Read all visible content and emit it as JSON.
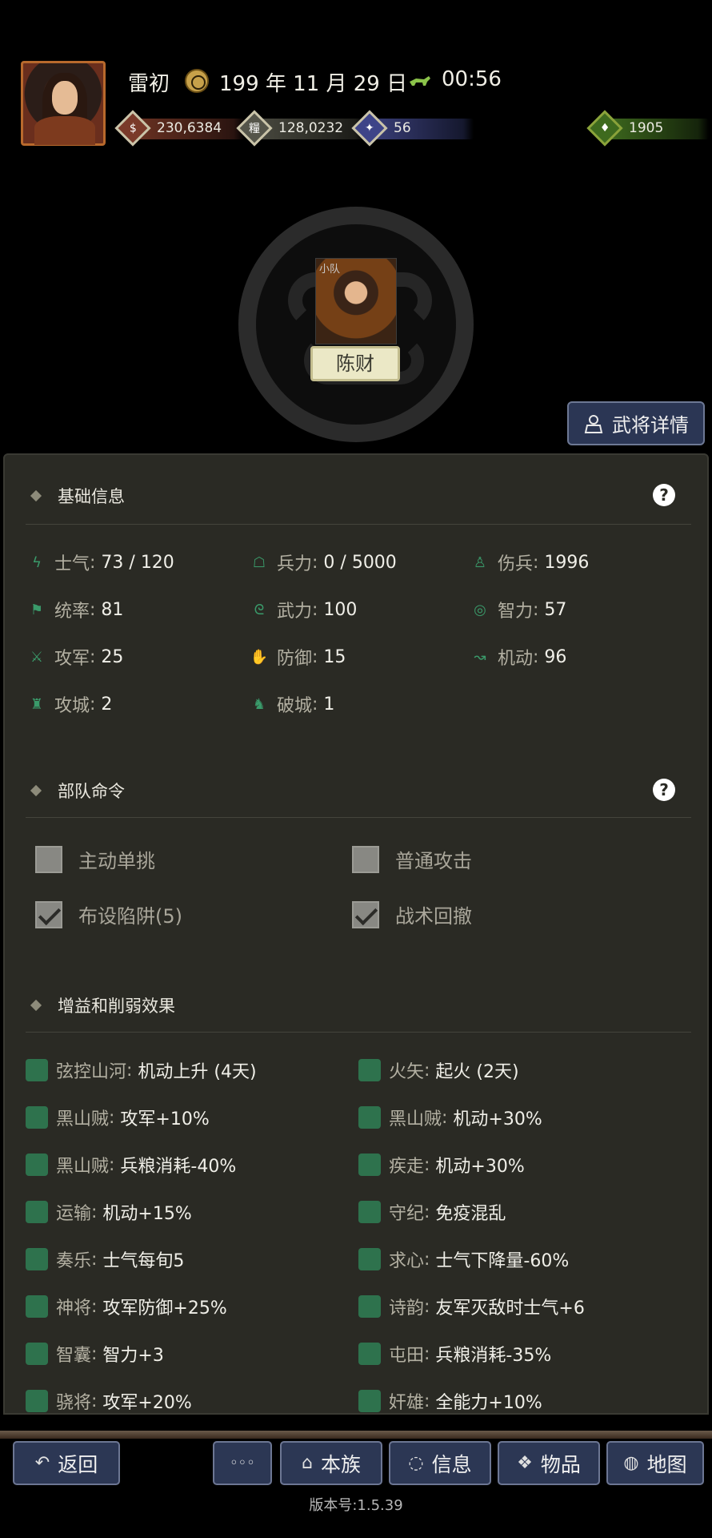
{
  "header": {
    "lord_name": "雷初",
    "date": "199 年 11 月 29 日",
    "time": "00:56",
    "resources": [
      {
        "name": "gold",
        "value": "230,6384",
        "color": "#7a3a2a",
        "glyph": "$"
      },
      {
        "name": "food",
        "value": "128,0232",
        "color": "#4a4a40",
        "glyph": "糧"
      },
      {
        "name": "troops",
        "value": "56",
        "color": "#3a3f7a",
        "glyph": "✦"
      },
      {
        "name": "supply",
        "value": "1905",
        "color": "#3e6a1e",
        "glyph": "♦"
      }
    ]
  },
  "unit": {
    "tag": "小队",
    "commander": "陈财",
    "detail_button": "武将详情"
  },
  "basic_info": {
    "title": "基础信息",
    "stats": [
      {
        "icon": "morale-icon",
        "label": "士气",
        "value": "73 / 120"
      },
      {
        "icon": "soldier-icon",
        "label": "兵力",
        "value": "0 / 5000"
      },
      {
        "icon": "wounded-icon",
        "label": "伤兵",
        "value": "1996"
      },
      {
        "icon": "flag-icon",
        "label": "统率",
        "value": "81"
      },
      {
        "icon": "strength-icon",
        "label": "武力",
        "value": "100"
      },
      {
        "icon": "brain-icon",
        "label": "智力",
        "value": "57"
      },
      {
        "icon": "swords-icon",
        "label": "攻军",
        "value": "25"
      },
      {
        "icon": "shield-hand-icon",
        "label": "防御",
        "value": "15"
      },
      {
        "icon": "mobility-icon",
        "label": "机动",
        "value": "96"
      },
      {
        "icon": "siege-tower-icon",
        "label": "攻城",
        "value": "2"
      },
      {
        "icon": "ram-horse-icon",
        "label": "破城",
        "value": "1"
      }
    ]
  },
  "commands": {
    "title": "部队命令",
    "options": [
      {
        "label": "主动单挑",
        "checked": false
      },
      {
        "label": "普通攻击",
        "checked": false
      },
      {
        "label": "布设陷阱(5)",
        "checked": true
      },
      {
        "label": "战术回撤",
        "checked": true
      }
    ]
  },
  "effects": {
    "title": "增益和削弱效果",
    "items": [
      {
        "label": "弦控山河",
        "value": "机动上升 (4天)"
      },
      {
        "label": "火矢",
        "value": "起火 (2天)"
      },
      {
        "label": "黑山贼",
        "value": "攻军+10%"
      },
      {
        "label": "黑山贼",
        "value": "机动+30%"
      },
      {
        "label": "黑山贼",
        "value": "兵粮消耗-40%"
      },
      {
        "label": "疾走",
        "value": "机动+30%"
      },
      {
        "label": "运输",
        "value": "机动+15%"
      },
      {
        "label": "守纪",
        "value": "免疫混乱"
      },
      {
        "label": "奏乐",
        "value": "士气每旬5"
      },
      {
        "label": "求心",
        "value": "士气下降量-60%"
      },
      {
        "label": "神将",
        "value": "攻军防御+25%"
      },
      {
        "label": "诗韵",
        "value": "友军灭敌时士气+6"
      },
      {
        "label": "智囊",
        "value": "智力+3"
      },
      {
        "label": "屯田",
        "value": "兵粮消耗-35%"
      },
      {
        "label": "骁将",
        "value": "攻军+20%"
      },
      {
        "label": "奸雄",
        "value": "全能力+10%"
      }
    ]
  },
  "nav": {
    "back": "返回",
    "more": "◦◦◦",
    "clan": "本族",
    "info": "信息",
    "items": "物品",
    "map": "地图"
  },
  "version": "版本号:1.5.39"
}
